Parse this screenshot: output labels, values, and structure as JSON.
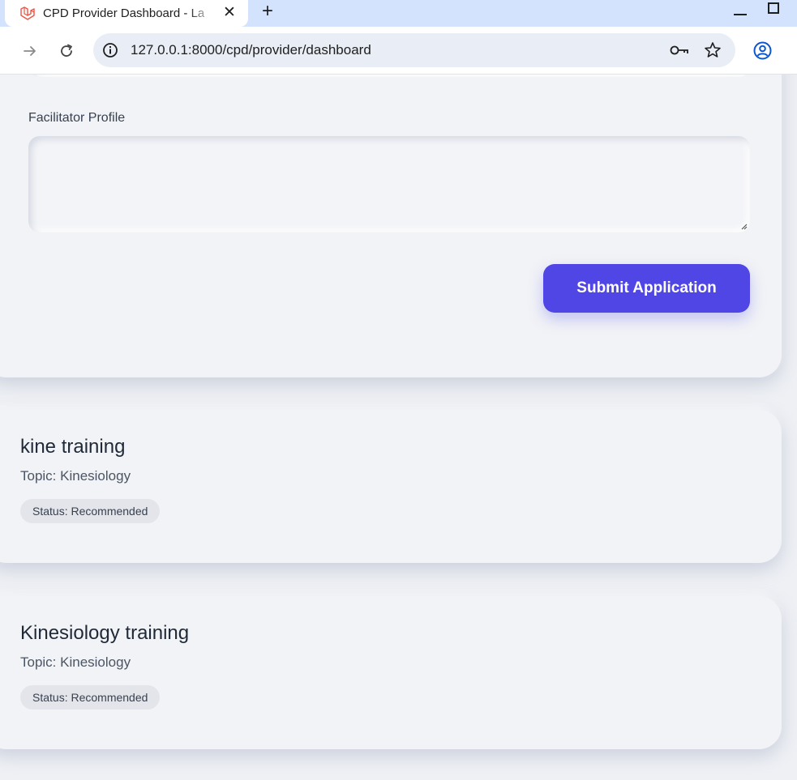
{
  "browser": {
    "tab_title": "CPD Provider Dashboard - La",
    "tab_close": "✕",
    "new_tab": "+",
    "url": "127.0.0.1:8000/cpd/provider/dashboard"
  },
  "form": {
    "facilitator_label": "Facilitator Profile",
    "facilitator_value": "",
    "submit_label": "Submit Application"
  },
  "courses": [
    {
      "title": "kine training",
      "topic": "Topic: Kinesiology",
      "status": "Status: Recommended"
    },
    {
      "title": "Kinesiology training",
      "topic": "Topic: Kinesiology",
      "status": "Status: Recommended"
    }
  ],
  "colors": {
    "accent": "#4f46e5",
    "background": "#eef0f4",
    "card": "#f2f3f6"
  }
}
